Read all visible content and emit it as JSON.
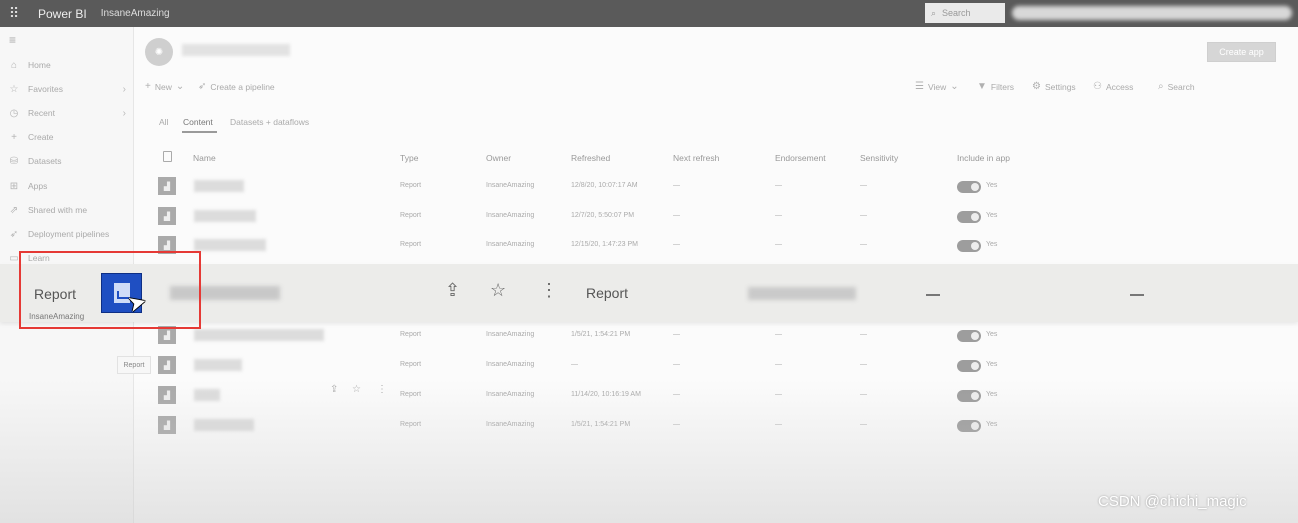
{
  "topbar": {
    "app_name": "Power BI",
    "workspace_name": "InsaneAmazing",
    "search_placeholder": "Search"
  },
  "sidebar": {
    "items": [
      {
        "label": "Home",
        "icon": "home-icon"
      },
      {
        "label": "Favorites",
        "icon": "star-icon",
        "chevron": true
      },
      {
        "label": "Recent",
        "icon": "clock-icon",
        "chevron": true
      },
      {
        "label": "Create",
        "icon": "plus-icon"
      },
      {
        "label": "Datasets",
        "icon": "database-icon"
      },
      {
        "label": "Apps",
        "icon": "apps-icon"
      },
      {
        "label": "Shared with me",
        "icon": "share-icon"
      },
      {
        "label": "Deployment pipelines",
        "icon": "rocket-icon"
      },
      {
        "label": "Learn",
        "icon": "book-icon"
      }
    ]
  },
  "header": {
    "create_app_label": "Create app"
  },
  "toolbar": {
    "new_label": "New",
    "pipeline_label": "Create a pipeline",
    "view_label": "View",
    "filters_label": "Filters",
    "settings_label": "Settings",
    "access_label": "Access",
    "search_label": "Search"
  },
  "tabs": [
    {
      "label": "All"
    },
    {
      "label": "Content",
      "active": true
    },
    {
      "label": "Datasets + dataflows"
    }
  ],
  "table": {
    "columns": [
      "Name",
      "Type",
      "Owner",
      "Refreshed",
      "Next refresh",
      "Endorsement",
      "Sensitivity",
      "Include in app"
    ],
    "rows": [
      {
        "type": "Report",
        "owner": "InsaneAmazing",
        "refreshed": "12/8/20, 10:07:17 AM",
        "next_refresh": "—",
        "endorsement": "—",
        "sensitivity": "—",
        "include": "Yes"
      },
      {
        "type": "Report",
        "owner": "InsaneAmazing",
        "refreshed": "12/7/20, 5:50:07 PM",
        "next_refresh": "—",
        "endorsement": "—",
        "sensitivity": "—",
        "include": "Yes"
      },
      {
        "type": "Report",
        "owner": "InsaneAmazing",
        "refreshed": "12/15/20, 1:47:23 PM",
        "next_refresh": "—",
        "endorsement": "—",
        "sensitivity": "—",
        "include": "Yes"
      },
      {
        "type": "Report",
        "owner": "InsaneAmazing",
        "refreshed": "1/5/21, 1:54:21 PM",
        "next_refresh": "—",
        "endorsement": "—",
        "sensitivity": "—",
        "include": "Yes"
      },
      {
        "type": "Report",
        "owner": "InsaneAmazing",
        "refreshed": "—",
        "next_refresh": "—",
        "endorsement": "—",
        "sensitivity": "—",
        "include": "Yes"
      },
      {
        "type": "Report",
        "owner": "InsaneAmazing",
        "refreshed": "11/14/20, 10:16:19 AM",
        "next_refresh": "—",
        "endorsement": "—",
        "sensitivity": "—",
        "include": "Yes"
      },
      {
        "type": "Report",
        "owner": "InsaneAmazing",
        "refreshed": "1/5/21, 1:54:21 PM",
        "next_refresh": "—",
        "endorsement": "—",
        "sensitivity": "—",
        "include": "Yes"
      }
    ]
  },
  "hover_tooltip": "Report",
  "drag_overlay": {
    "type_label": "Report",
    "owner": "InsaneAmazing",
    "type_column": "Report",
    "next_refresh": "—",
    "endorsement": "—"
  },
  "watermark": "CSDN @chichi_magic",
  "colors": {
    "topbar": "#5a5a5a",
    "highlight_box": "#e53935",
    "report_icon": "#1f4fc2"
  }
}
